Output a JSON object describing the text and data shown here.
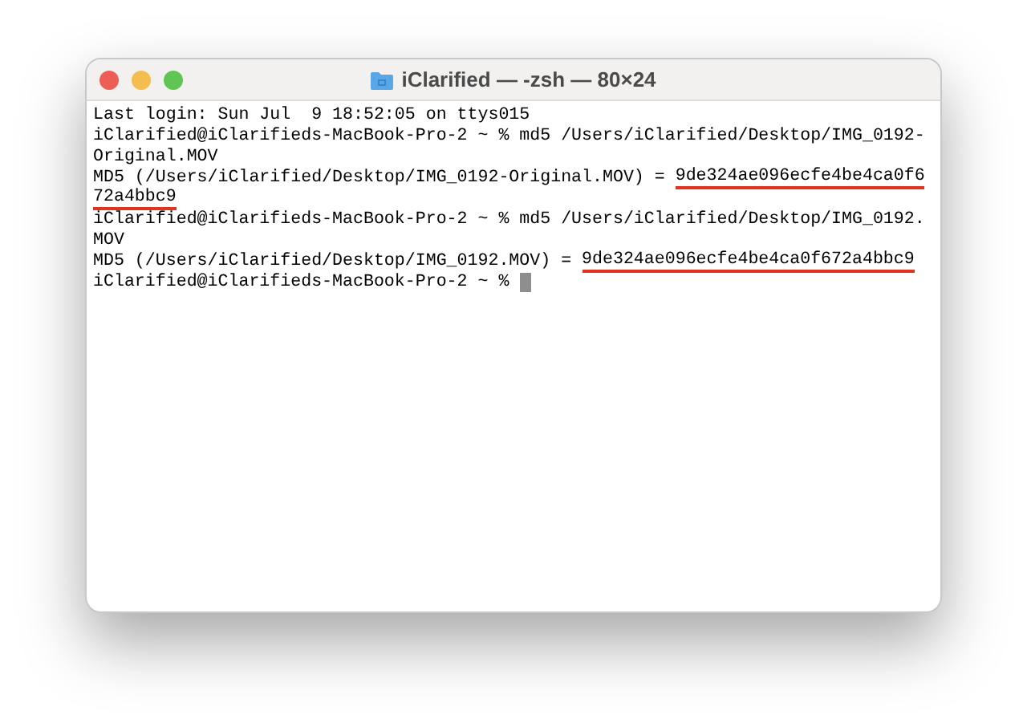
{
  "window": {
    "title": "iClarified — -zsh — 80×24"
  },
  "terminal": {
    "lines": [
      [
        {
          "text": "Last login: Sun Jul  9 18:52:05 on ttys015",
          "underlined": false
        }
      ],
      [
        {
          "text": "iClarified@iClarifieds-MacBook-Pro-2 ~ % md5 /Users/iClarified/Desktop/IMG_0192-",
          "underlined": false
        }
      ],
      [
        {
          "text": "Original.MOV",
          "underlined": false
        }
      ],
      [
        {
          "text": "MD5 (/Users/iClarified/Desktop/IMG_0192-Original.MOV) = ",
          "underlined": false
        },
        {
          "text": "9de324ae096ecfe4be4ca0f6",
          "underlined": true
        }
      ],
      [
        {
          "text": "72a4bbc9",
          "underlined": true
        }
      ],
      [
        {
          "text": "iClarified@iClarifieds-MacBook-Pro-2 ~ % md5 /Users/iClarified/Desktop/IMG_0192.",
          "underlined": false
        }
      ],
      [
        {
          "text": "MOV",
          "underlined": false
        }
      ],
      [
        {
          "text": "MD5 (/Users/iClarified/Desktop/IMG_0192.MOV) = ",
          "underlined": false
        },
        {
          "text": "9de324ae096ecfe4be4ca0f672a4bbc9",
          "underlined": true
        }
      ],
      [
        {
          "text": "iClarified@iClarifieds-MacBook-Pro-2 ~ % ",
          "underlined": false
        }
      ]
    ],
    "cursor": true
  }
}
